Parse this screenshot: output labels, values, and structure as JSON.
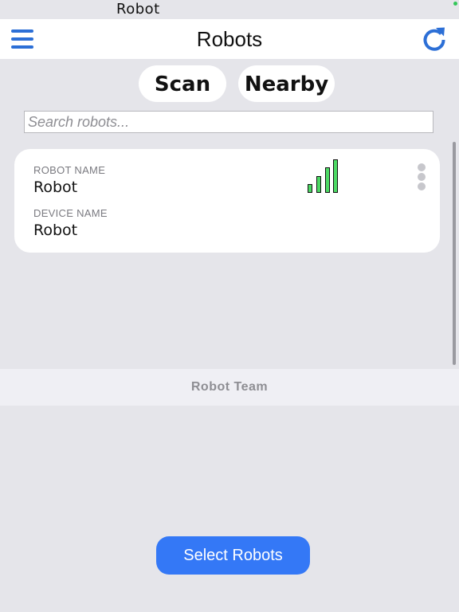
{
  "status_bar": {
    "app_name": "Robot"
  },
  "nav": {
    "title": "Robots",
    "left_icon": "menu-icon",
    "right_icon": "refresh-icon",
    "accent_color": "#2c6fd6"
  },
  "actions": {
    "scan_label": "Scan",
    "nearby_label": "Nearby"
  },
  "search": {
    "placeholder": "Search robots...",
    "value": ""
  },
  "robots": [
    {
      "robot_name_label": "ROBOT NAME",
      "robot_name": "Robot",
      "device_name_label": "DEVICE NAME",
      "device_name": "Robot",
      "signal_bars": 4,
      "signal_color": "#4cd964",
      "more_icon": "more-vertical-icon"
    }
  ],
  "team": {
    "header": "Robot Team"
  },
  "footer": {
    "select_label": "Select Robots",
    "button_color": "#3478f6"
  }
}
